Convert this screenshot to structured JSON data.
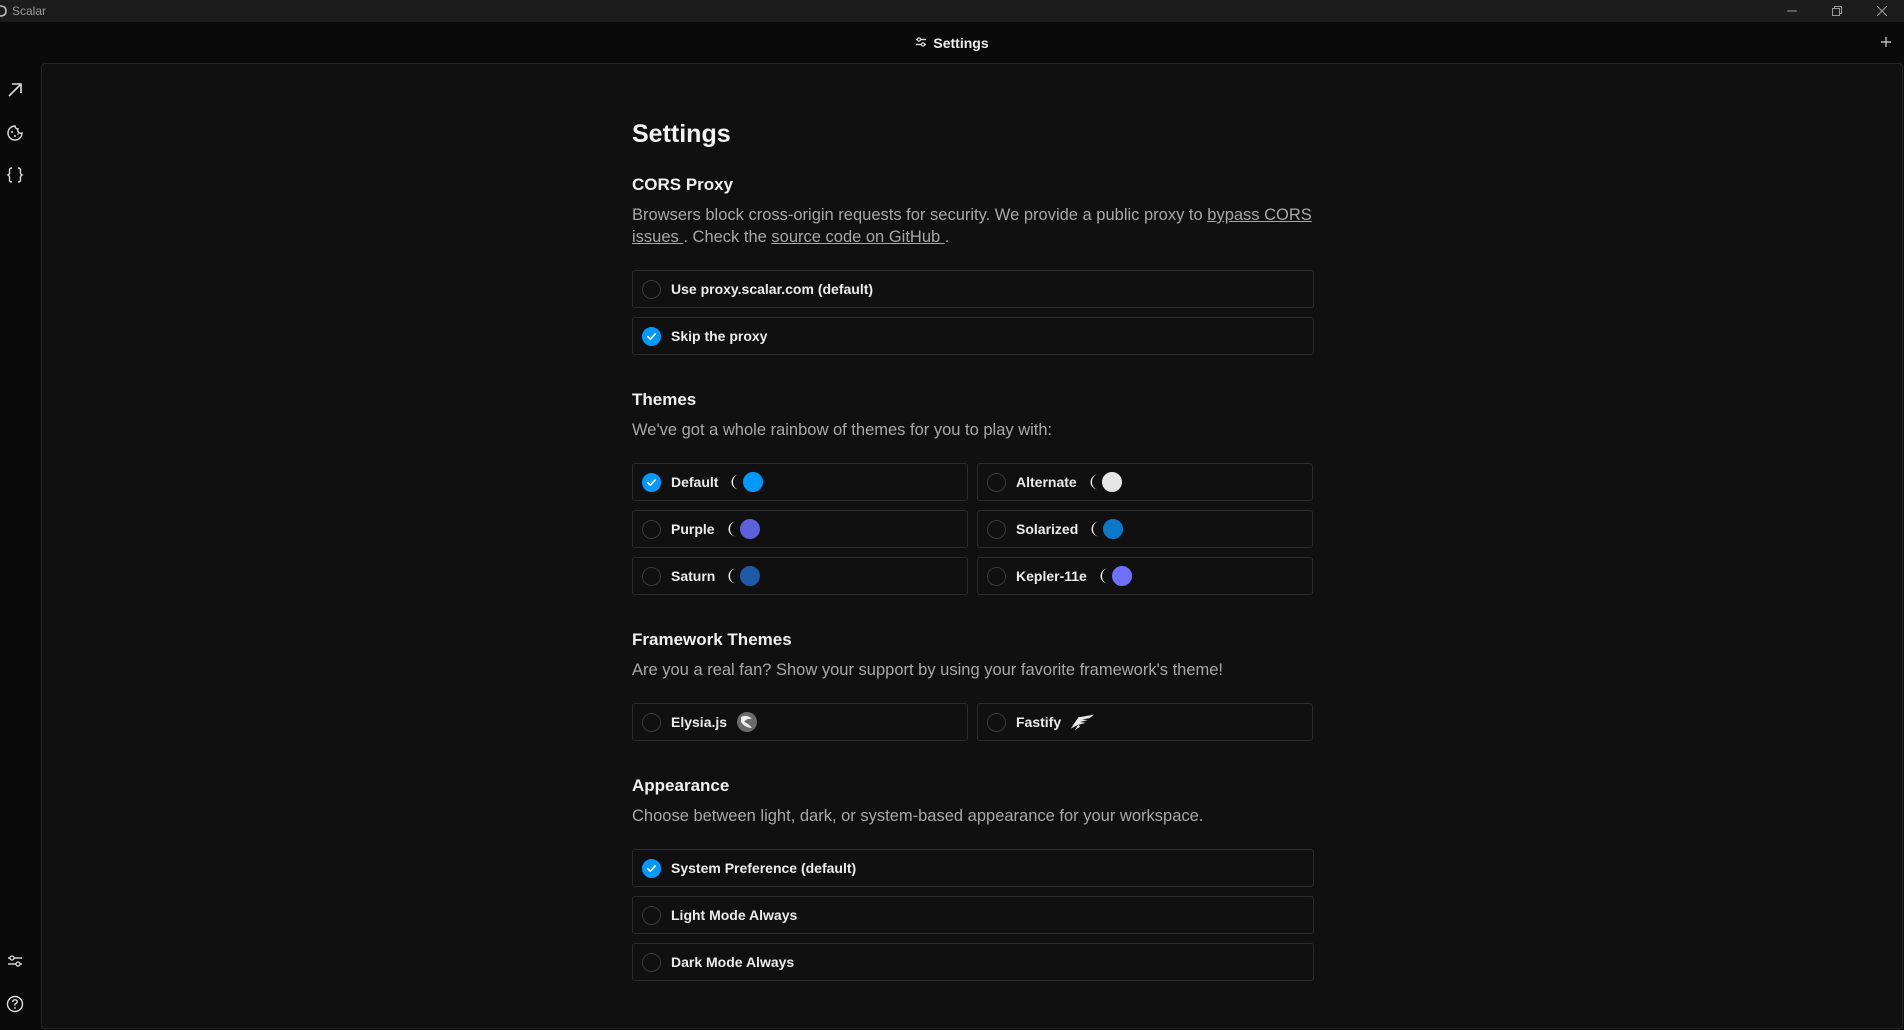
{
  "window": {
    "title": "Scalar"
  },
  "topbar": {
    "tab_title": "Settings"
  },
  "page": {
    "title": "Settings"
  },
  "cors": {
    "title": "CORS Proxy",
    "desc_pre": "Browsers block cross-origin requests for security. We provide a public proxy to ",
    "link1": "bypass CORS issues ",
    "desc_mid": ". Check the ",
    "link2": "source code on GitHub ",
    "desc_post": ".",
    "options": [
      {
        "label": "Use proxy.scalar.com (default)",
        "checked": false
      },
      {
        "label": "Skip the proxy",
        "checked": true
      }
    ]
  },
  "themes": {
    "title": "Themes",
    "desc": "We've got a whole rainbow of themes for you to play with:",
    "options": [
      {
        "label": "Default",
        "checked": true,
        "color": "#0099ff",
        "moon": "#f2f2f2"
      },
      {
        "label": "Alternate",
        "checked": false,
        "color": "#e6e6e6",
        "moon": "#f2f2f2"
      },
      {
        "label": "Purple",
        "checked": false,
        "color": "#5d5fdb",
        "moon": "#f2f2f2"
      },
      {
        "label": "Solarized",
        "checked": false,
        "color": "#0a78c8",
        "moon": "#f2f2f2"
      },
      {
        "label": "Saturn",
        "checked": false,
        "color": "#1f5aa8",
        "moon": "#f2f2f2"
      },
      {
        "label": "Kepler-11e",
        "checked": false,
        "color": "#7070ff",
        "moon": "#f2f2f2"
      }
    ]
  },
  "framework": {
    "title": "Framework Themes",
    "desc": "Are you a real fan? Show your support by using your favorite framework's theme!",
    "options": [
      {
        "label": "Elysia.js",
        "checked": false,
        "icon": "elysia-logo-icon"
      },
      {
        "label": "Fastify",
        "checked": false,
        "icon": "fastify-logo-icon"
      }
    ]
  },
  "appearance": {
    "title": "Appearance",
    "desc": "Choose between light, dark, or system-based appearance for your workspace.",
    "options": [
      {
        "label": "System Preference (default)",
        "checked": true
      },
      {
        "label": "Light Mode Always",
        "checked": false
      },
      {
        "label": "Dark Mode Always",
        "checked": false
      }
    ]
  },
  "colors": {
    "accent": "#0099ff",
    "background": "#0a0a0a",
    "panel": "#101010",
    "border": "#2c2c2c"
  }
}
